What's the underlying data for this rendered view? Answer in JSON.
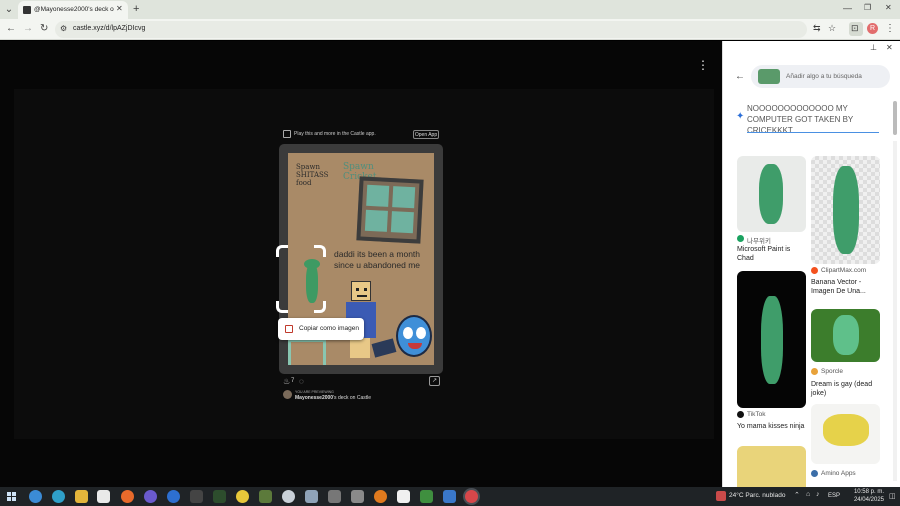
{
  "browser": {
    "tab_title": "@Mayonesse2000's deck on C...",
    "new_tab_label": "+",
    "url": "castle.xyz/d/lpAZjDIcvg",
    "window_controls": [
      "—",
      "❐",
      "✕"
    ],
    "profile_initial": "R"
  },
  "castle": {
    "banner_text": "Play this and more in the Castle app.",
    "open_app_label": "Open App",
    "card_texts": {
      "spawn_shitass_food": "Spawn SHITASS food",
      "spawn_cricket": "Spawn Cricket",
      "message": "daddi its been a month since u abandoned me"
    },
    "likes_count": "7",
    "previewing_label": "YOU ARE PREVIEWING",
    "deck_name_bold": "Mayonesse2000",
    "deck_name_rest": "'s deck on Castle",
    "copy_as_image_label": "Copiar como imagen"
  },
  "lens": {
    "search_placeholder": "Añadir algo a tu búsqueda",
    "query_text": "NOOOOOOOOOOOOO MY COMPUTER GOT TAKEN BY CRICEKKKT",
    "results": [
      {
        "source": "나무위키",
        "title": "Microsoft Paint is Chad",
        "source_color": "#1aa260"
      },
      {
        "source": "ClipartMax.com",
        "title": "Banana Vector - Imagen De Una...",
        "source_color": "#f4511e"
      },
      {
        "source": "TikTok",
        "title": "Yo mama kisses ninja",
        "source_color": "#111111"
      },
      {
        "source": "Sporcle",
        "title": "Dream is gay (dead joke)",
        "source_color": "#e8a23a"
      },
      {
        "source": "Amino Apps",
        "title": "",
        "source_color": "#3b6ea8"
      }
    ]
  },
  "taskbar": {
    "weather": "24°C  Parc. nublado",
    "language": "ESP",
    "time": "10:58 p. m.",
    "date": "24/04/2025"
  }
}
